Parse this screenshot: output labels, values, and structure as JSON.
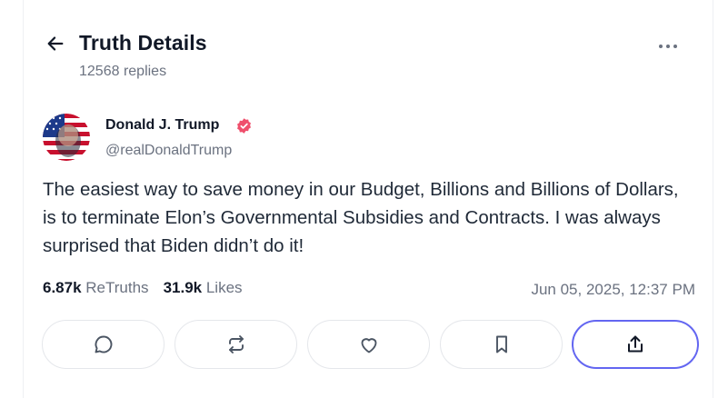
{
  "header": {
    "title": "Truth Details",
    "reply_count": "12568 replies"
  },
  "author": {
    "name": "Donald J. Trump",
    "handle": "@realDonaldTrump",
    "verified": true
  },
  "post": {
    "text": "The easiest way to save money in our Budget, Billions and Billions of Dollars, is to terminate Elon’s Governmental Subsidies and Contracts. I was always surprised that Biden didn’t do it!",
    "retruths_count": "6.87k",
    "retruths_label": "ReTruths",
    "likes_count": "31.9k",
    "likes_label": "Likes",
    "timestamp": "Jun 05, 2025, 12:37 PM"
  },
  "actions": [
    {
      "name": "reply",
      "icon": "comment-icon"
    },
    {
      "name": "retruth",
      "icon": "repost-icon"
    },
    {
      "name": "like",
      "icon": "heart-icon"
    },
    {
      "name": "bookmark",
      "icon": "bookmark-icon"
    },
    {
      "name": "share",
      "icon": "share-icon"
    }
  ],
  "colors": {
    "accent": "#6366f1",
    "verified": "#ef4f6c",
    "muted_text": "#6b7280",
    "primary_text": "#111827"
  }
}
